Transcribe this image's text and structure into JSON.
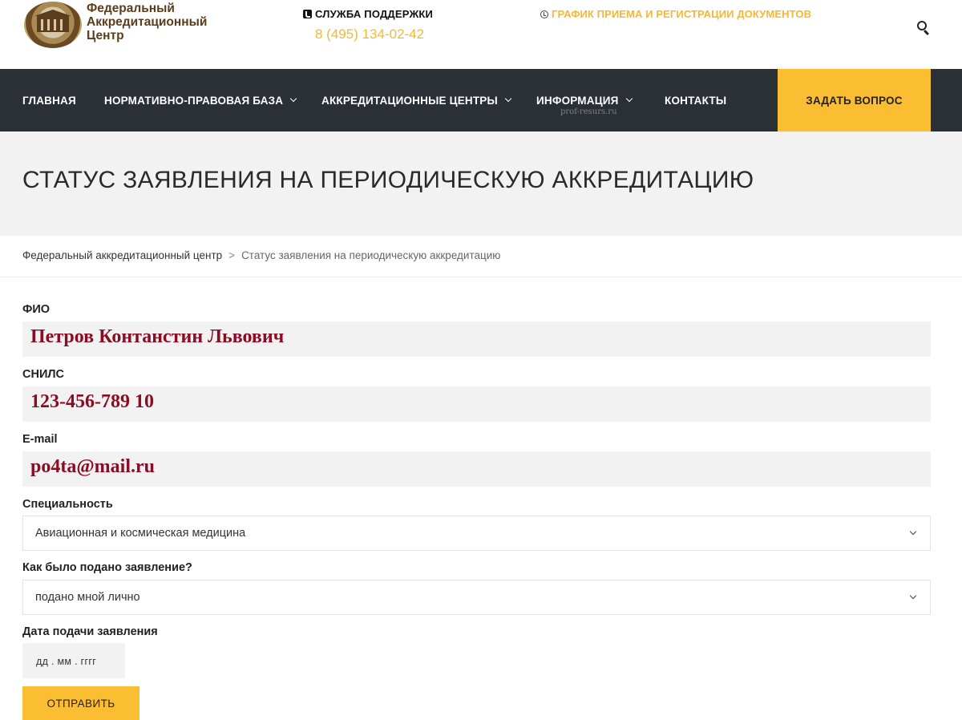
{
  "header": {
    "logo": {
      "line1": "Федеральный",
      "line2": "Аккредитационный",
      "line3": "Центр"
    },
    "support": {
      "title": "СЛУЖБА ПОДДЕРЖКИ",
      "phone": "8 (495) 134-02-42"
    },
    "schedule_link": "ГРАФИК ПРИЕМА И РЕГИСТРАЦИИ ДОКУМЕНТОВ"
  },
  "nav": {
    "items": [
      {
        "label": "ГЛАВНАЯ"
      },
      {
        "label": "НОРМАТИВНО-ПРАВОВАЯ БАЗА"
      },
      {
        "label": "АККРЕДИТАЦИОННЫЕ ЦЕНТРЫ"
      },
      {
        "label": "ИНФОРМАЦИЯ"
      },
      {
        "label": "КОНТАКТЫ"
      }
    ],
    "watermark": "prof-resurs.ru",
    "ask_button": "ЗАДАТЬ ВОПРОС"
  },
  "page": {
    "title": "СТАТУС ЗАЯВЛЕНИЯ НА ПЕРИОДИЧЕСКУЮ АККРЕДИТАЦИЮ"
  },
  "breadcrumb": {
    "home": "Федеральный аккредитационный центр",
    "separator": ">",
    "current": "Статус заявления на периодическую аккредитацию"
  },
  "form": {
    "fio": {
      "label": "ФИО",
      "value": "Петров Контанстин Львович"
    },
    "snils": {
      "label": "СНИЛС",
      "value": "123-456-789 10"
    },
    "email": {
      "label": "E-mail",
      "value": "po4ta@mail.ru"
    },
    "specialty": {
      "label": "Специальность",
      "selected": "Авиационная и космическая медицина"
    },
    "submission_method": {
      "label": "Как было подано заявление?",
      "selected": "подано мной лично"
    },
    "date": {
      "label": "Дата подачи заявления",
      "placeholder": "дд . мм . гггг"
    },
    "submit_label": "ОТПРАВИТЬ"
  },
  "colors": {
    "accent": "#fbbd32",
    "nav_bg": "#2b2f36",
    "handwritten_value": "#8b0d24"
  }
}
